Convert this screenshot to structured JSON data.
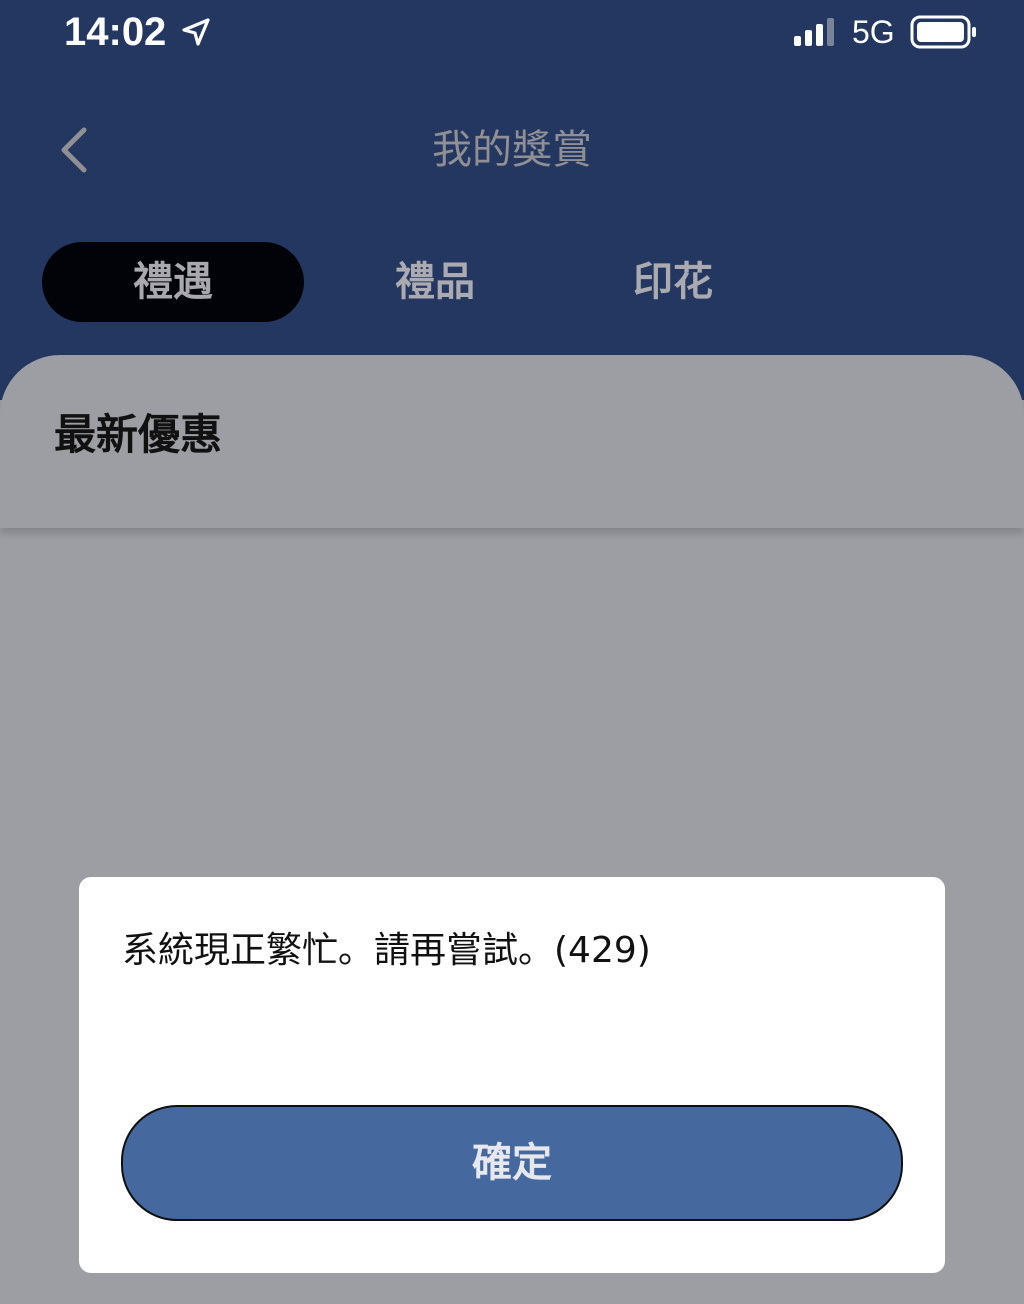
{
  "status_bar": {
    "time": "14:02",
    "network": "5G",
    "location_icon": "location-arrow-icon",
    "signal_icon": "cellular-signal-icon",
    "battery_icon": "battery-icon"
  },
  "nav": {
    "title": "我的獎賞",
    "back_icon": "chevron-left-icon"
  },
  "tabs": [
    {
      "label": "禮遇",
      "active": true
    },
    {
      "label": "禮品",
      "active": false
    },
    {
      "label": "印花",
      "active": false
    }
  ],
  "section": {
    "title": "最新優惠"
  },
  "dialog": {
    "message": "系統現正繁忙。請再嘗試。(429)",
    "confirm_label": "確定"
  },
  "colors": {
    "header_bg": "#233760",
    "overlay_bg": "#9d9ea3",
    "active_tab_bg": "#010308",
    "confirm_button_bg": "#45699e",
    "dialog_bg": "#ffffff"
  }
}
